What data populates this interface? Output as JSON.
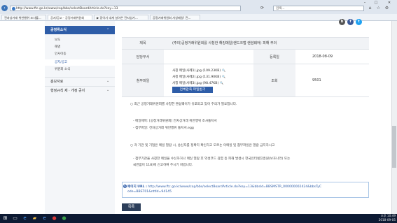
{
  "browser": {
    "url": "http://www.ftc.go.kr/www/cop/bbs/selectBoardArticle.do?key=13",
    "search_placeholder": "검색...",
    "tabs": [
      "전자상거래 위반행위 조사를...",
      "공지/공고 - 공정거래위원회",
      "▶ 깡이기 내게 날아온 전자상거...",
      "공정거래위원회 사칭메일! 전..."
    ],
    "back_icon": "back-arrow-icon",
    "forward_icon": "forward-arrow-icon"
  },
  "sidebar": {
    "heading": "공정위소식",
    "items": [
      "보도",
      "해명",
      "인사이동",
      "공지/공고",
      "위원회 소식"
    ],
    "selected": "공지/공고",
    "sections": [
      "홍보자료",
      "행정규칙 제 · 개정 공지"
    ]
  },
  "share_icons": [
    {
      "name": "blog-icon",
      "glyph": "b",
      "color": "#555555"
    },
    {
      "name": "facebook-icon",
      "glyph": "f",
      "color": "#3b5998"
    },
    {
      "name": "twitter-icon",
      "glyph": "t",
      "color": "#1da1f2"
    }
  ],
  "article": {
    "title_label": "제목",
    "title": "(주의)공정거래위원회를 사칭한 해킹메일(랜드크랩 랜섬웨어) 피해 주의",
    "dept_label": "담당부서",
    "dept": "",
    "date_label": "등록일",
    "date": "2018-08-09",
    "attach_label": "첨부파일",
    "files": [
      "사칭 메일(사례1).jpg (109.23KB)",
      "사칭 메일(사례2).jpg (131.90KB)",
      "사칭 메일(사례3).jpg (98.47KB)"
    ],
    "download_all": "전체압축 파일받기",
    "views_label": "조회",
    "views": "9501"
  },
  "body": {
    "p1": "○ 최근 공정거래위원회를 사칭한 랜섬웨어가 유포되고 있어 주의가 필요합니다.",
    "p2": "- 메일제목: [공정거래위원회] 전자상거래 위반행위 조사통지서",
    "p3": "- 첨부파일: 전자상거래 위반행위 통지서.egg",
    "p4": "○ 각 기관 및 기업은 메일 열람 시, 송신자를 정확히 확인하고 모르는 이메일 및 첨부파일은 열람 금지하시고",
    "p5": "- 첨부기관을 사칭한 메일을 수신하거나 메일 열람 후 악성코드 감염 등 피해 발생시 한국인터넷진흥원(보호나라) 또는",
    "p6": "국번없이 118)에 신고하여 주시기 바랍니다."
  },
  "url_box": {
    "label": "페이지 URL :",
    "url_line1": "http://www.ftc.go.kr/www/cop/bbs/selectBoardArticle.do?key=13&bbsId=BBSMSTR_000000002424&bbsTyC",
    "url_line2": "ode=BBST01&nttId=94145"
  },
  "list_button": "목록",
  "taskbar": {
    "time": "오후 10:49",
    "date": "2018-09-05"
  }
}
